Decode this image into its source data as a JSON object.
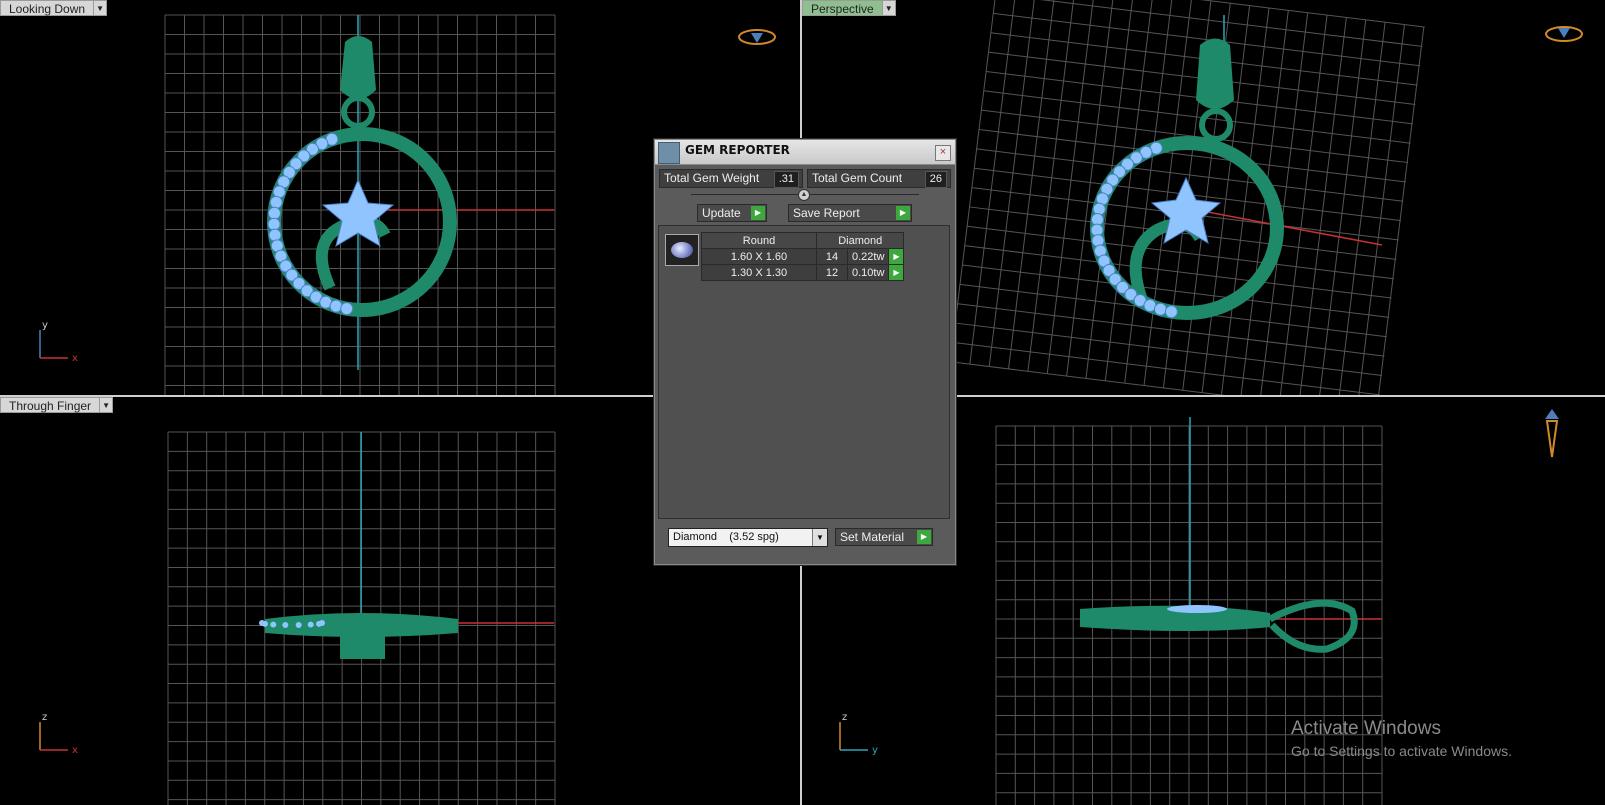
{
  "viewports": {
    "top_left": {
      "label": "Looking Down",
      "axis_h": "x",
      "axis_v": "y"
    },
    "top_right": {
      "label": "Perspective"
    },
    "bottom_left": {
      "label": "Through Finger",
      "axis_h": "x",
      "axis_v": "z"
    },
    "bottom_right": {
      "label": "",
      "axis_h": "y",
      "axis_v": "z"
    }
  },
  "dropdown_glyph": "▼",
  "gem_reporter": {
    "title": "GEM REPORTER",
    "close_glyph": "×",
    "total_gem_weight_label": "Total Gem Weight",
    "total_gem_weight": ".31",
    "total_gem_count_label": "Total Gem Count",
    "total_gem_count": "26",
    "update_label": "Update",
    "save_report_label": "Save Report",
    "go_glyph": "▶",
    "table": {
      "shape": "Round",
      "material": "Diamond",
      "rows": [
        {
          "size": "1.60 X 1.60",
          "count": "14",
          "weight": "0.22tw"
        },
        {
          "size": "1.30 X 1.30",
          "count": "12",
          "weight": "0.10tw"
        }
      ]
    },
    "material_select": "Diamond    (3.52 spg)",
    "set_material_label": "Set Material"
  },
  "watermark": {
    "line1": "Activate Windows",
    "line2": "Go to Settings to activate Windows."
  },
  "colors": {
    "grid": "#6a6a6a",
    "metal": "#1f8a6a",
    "gem": "#8fc4ff",
    "axis_red": "#c83232",
    "axis_teal": "#2aa6b8"
  }
}
